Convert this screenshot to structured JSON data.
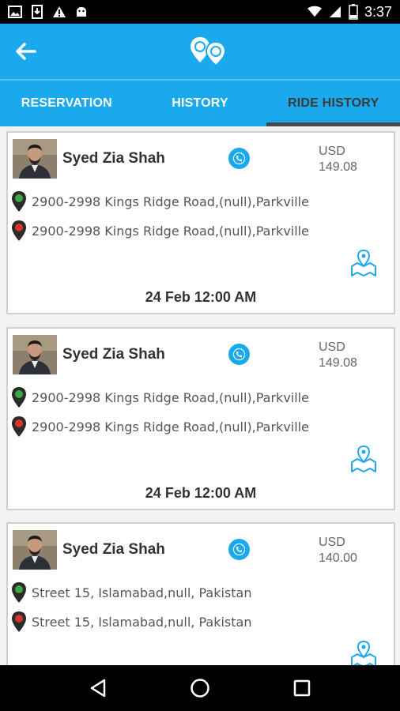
{
  "status_bar": {
    "time": "3:37",
    "battery_level": "2"
  },
  "app_bar": {
    "back_icon": "arrow-left-icon",
    "logo_icon": "map-pins-logo"
  },
  "tabs": [
    {
      "label": "RESERVATION",
      "active": false
    },
    {
      "label": "HISTORY",
      "active": false
    },
    {
      "label": "RIDE HISTORY",
      "active": true
    }
  ],
  "rides": [
    {
      "driver_name": "Syed Zia Shah",
      "currency": "USD",
      "amount": "149.08",
      "pickup": "2900-2998 Kings Ridge Road,(null),Parkville",
      "dropoff": "2900-2998 Kings Ridge Road,(null),Parkville",
      "date": "24 Feb 12:00 AM"
    },
    {
      "driver_name": "Syed Zia Shah",
      "currency": "USD",
      "amount": "149.08",
      "pickup": "2900-2998 Kings Ridge Road,(null),Parkville",
      "dropoff": "2900-2998 Kings Ridge Road,(null),Parkville",
      "date": "24 Feb 12:00 AM"
    },
    {
      "driver_name": "Syed Zia Shah",
      "currency": "USD",
      "amount": "140.00",
      "pickup": "Street 15, Islamabad,null, Pakistan",
      "dropoff": "Street 15, Islamabad,null, Pakistan",
      "date": ""
    }
  ],
  "colors": {
    "primary": "#1ba9ee",
    "pickup_pin": "#3aa845",
    "dropoff_pin": "#d9342b"
  }
}
